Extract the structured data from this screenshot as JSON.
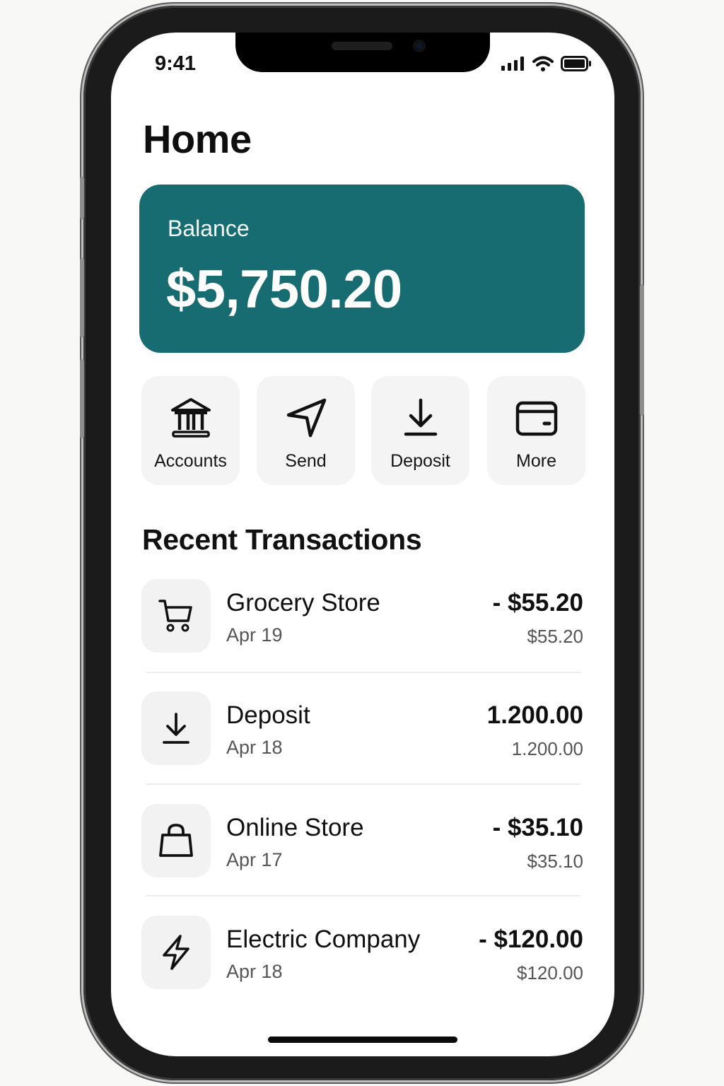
{
  "status_bar": {
    "time": "9:41",
    "icons": [
      "cellular-signal-icon",
      "wifi-icon",
      "battery-icon"
    ]
  },
  "header": {
    "title": "Home"
  },
  "balance": {
    "label": "Balance",
    "amount": "$5,750.20",
    "card_color": "#176c72"
  },
  "quick_actions": [
    {
      "label": "Accounts",
      "icon": "bank-icon"
    },
    {
      "label": "Send",
      "icon": "send-icon"
    },
    {
      "label": "Deposit",
      "icon": "download-icon"
    },
    {
      "label": "More",
      "icon": "wallet-icon"
    }
  ],
  "transactions_section": {
    "title": "Recent Transactions",
    "items": [
      {
        "name": "Grocery Store",
        "date": "Apr 19",
        "amount": "- $55.20",
        "secondary_amount": "$55.20",
        "icon": "cart-icon"
      },
      {
        "name": "Deposit",
        "date": "Apr 18",
        "amount": "1.200.00",
        "secondary_amount": "1.200.00",
        "icon": "download-icon"
      },
      {
        "name": "Online Store",
        "date": "Apr 17",
        "amount": "- $35.10",
        "secondary_amount": "$35.10",
        "icon": "shopping-bag-icon"
      },
      {
        "name": "Electric Company",
        "date": "Apr 18",
        "amount": "- $120.00",
        "secondary_amount": "$120.00",
        "icon": "lightning-icon"
      }
    ]
  }
}
